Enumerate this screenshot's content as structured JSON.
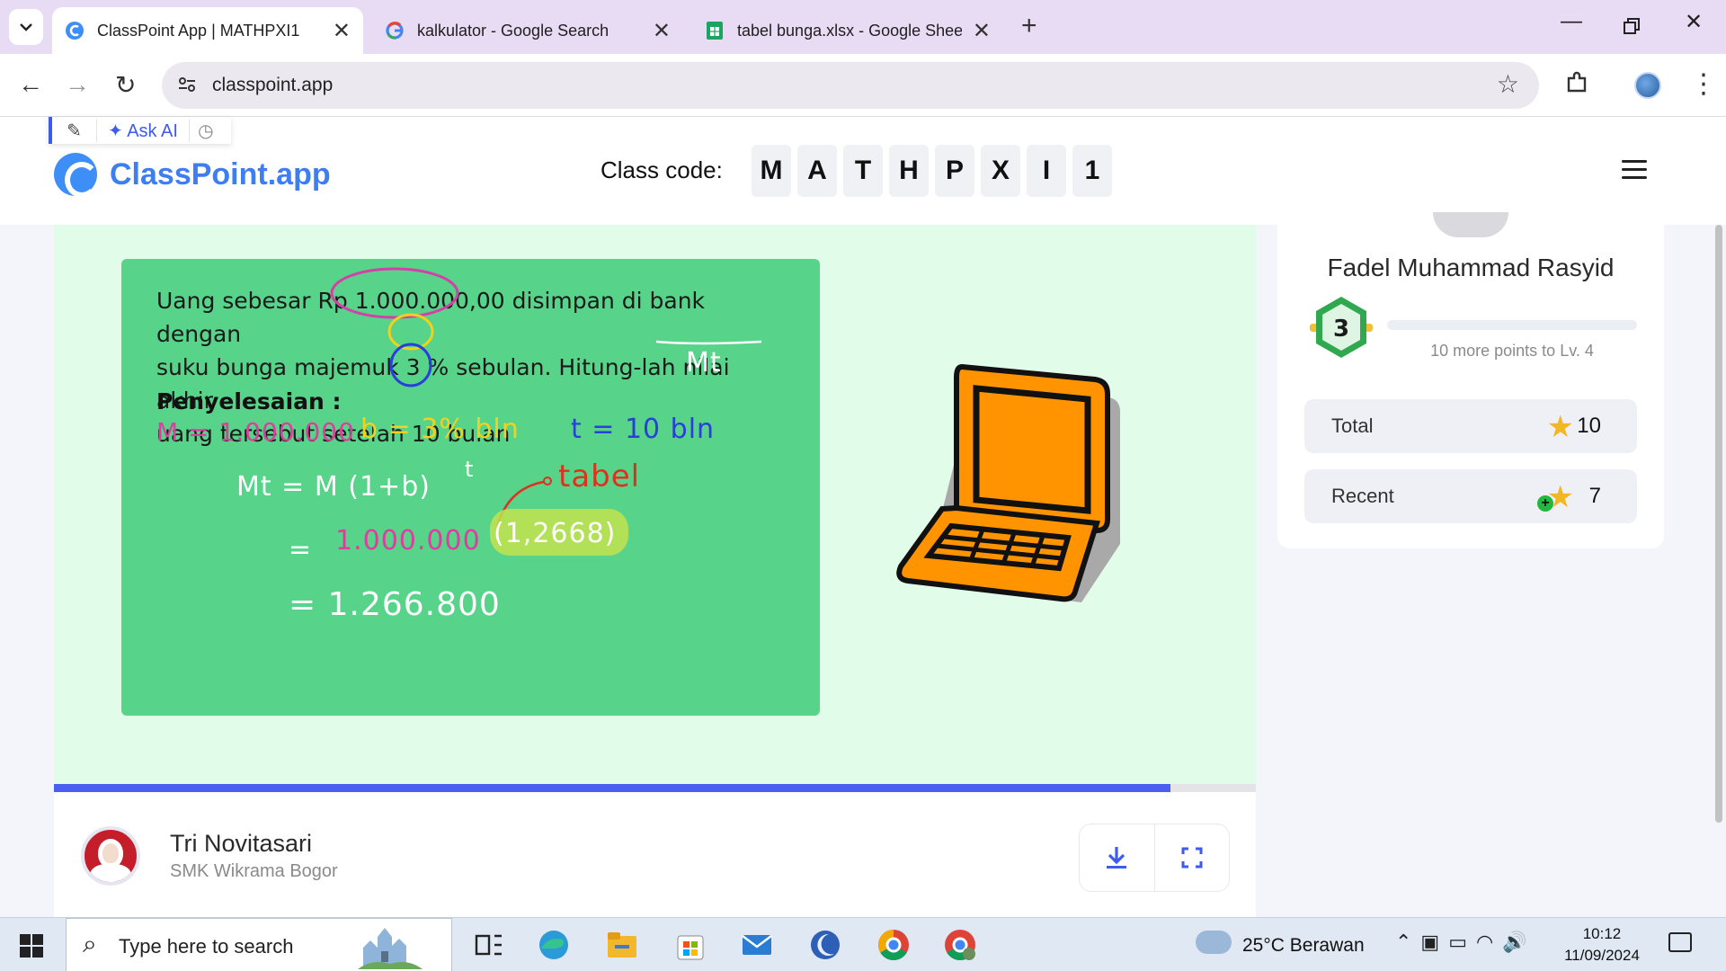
{
  "browser": {
    "tabs": [
      {
        "title": "ClassPoint App | MATHPXI1",
        "active": true,
        "icon": "classpoint-favicon"
      },
      {
        "title": "kalkulator - Google Search",
        "active": false,
        "icon": "google-favicon"
      },
      {
        "title": "tabel bunga.xlsx - Google Sheet",
        "active": false,
        "icon": "sheets-favicon"
      }
    ],
    "url": "classpoint.app"
  },
  "header": {
    "toolbox": {
      "ask_ai": "✦ Ask AI"
    },
    "logo_text": "ClassPoint.app",
    "class_code_label": "Class code:",
    "class_code": [
      "M",
      "A",
      "T",
      "H",
      "P",
      "X",
      "I",
      "1"
    ]
  },
  "slide": {
    "question_line1": "Uang sebesar Rp 1.000.000,00 disimpan di bank dengan",
    "question_line2": "suku bunga majemuk 3 % sebulan. Hitung-lah nilai akhir",
    "question_line3": "uang tersebut setelah 10 bulan",
    "solution_label": "Penyelesaian :",
    "ink": {
      "mt_label": "Mt",
      "m_value": "M = 1.000.000",
      "b_value": "b = 3% bln",
      "t_value": "t = 10 bln",
      "formula": "Mt = M (1+b)",
      "formula_exp": "t",
      "tabel_note": "tabel",
      "step1_eq": "=",
      "step1_m": "1.000.000",
      "step1_factor": "(1,2668)",
      "step2": "= 1.266.800"
    },
    "progress_fraction": 0.929,
    "colors": {
      "board": "#57d38a",
      "slide_bg": "#e1fde9",
      "accent": "#4a5ff0"
    }
  },
  "teacher": {
    "name": "Tri Novitasari",
    "school": "SMK Wikrama Bogor"
  },
  "student": {
    "name": "Fadel Muhammad Rasyid",
    "level": "3",
    "level_progress": "10 more points to Lv. 4",
    "level_fraction": 0.0,
    "total_label": "Total",
    "total_value": "10",
    "recent_label": "Recent",
    "recent_value": "7"
  },
  "taskbar": {
    "search_placeholder": "Type here to search",
    "weather": "25°C  Berawan",
    "time": "10:12",
    "date": "11/09/2024"
  }
}
